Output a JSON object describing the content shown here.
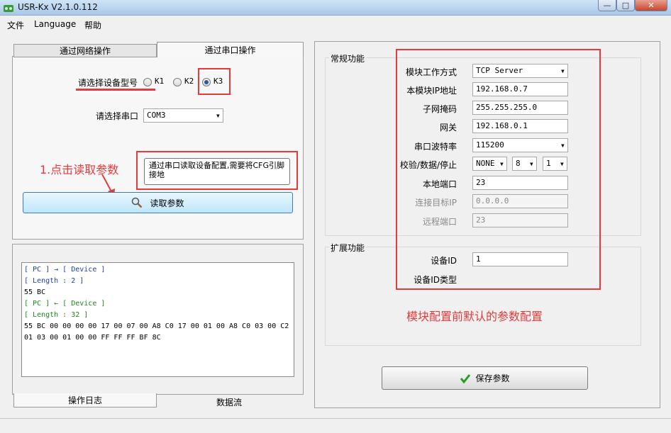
{
  "window": {
    "title": "USR-Kx V2.1.0.112"
  },
  "menu": {
    "file": "文件",
    "language": "Language",
    "help": "帮助"
  },
  "left": {
    "tabs": {
      "network": "通过网络操作",
      "serial": "通过串口操作"
    },
    "device_label": "请选择设备型号",
    "radios": {
      "k1": "K1",
      "k2": "K2",
      "k3": "K3"
    },
    "port_label": "请选择串口",
    "port_value": "COM3",
    "annotation": "1.点击读取参数",
    "tooltip": "通过串口读取设备配置,需要将CFG引脚接地",
    "read_button": "读取参数"
  },
  "log": {
    "lines": {
      "l1": "[ PC ] → [ Device ]",
      "l2": "[ Length : 2 ]",
      "l3": "55 BC",
      "l4": "[ PC ] ← [ Device ]",
      "l5": "[ Length : 32 ]",
      "l6": "55 BC 00 00 00 00 17 00 07 00 A8 C0 17 00 01 00 A8 C0 03 00 C2",
      "l7": "01 03 00 01 00 00 FF FF FF BF 8C"
    },
    "tabs": {
      "log": "操作日志",
      "stream": "数据流"
    }
  },
  "general": {
    "title": "常规功能",
    "mode_label": "模块工作方式",
    "mode_value": "TCP Server",
    "ip_label": "本模块IP地址",
    "ip_value": "192.168.0.7",
    "mask_label": "子网掩码",
    "mask_value": "255.255.255.0",
    "gateway_label": "网关",
    "gateway_value": "192.168.0.1",
    "baud_label": "串口波特率",
    "baud_value": "115200",
    "parity_label": "校验/数据/停止",
    "parity_value": "NONE",
    "data_value": "8",
    "stop_value": "1",
    "local_port_label": "本地端口",
    "local_port_value": "23",
    "target_ip_label": "连接目标IP",
    "target_ip_value": "0.0.0.0",
    "remote_port_label": "远程端口",
    "remote_port_value": "23"
  },
  "extended": {
    "title": "扩展功能",
    "device_id_label": "设备ID",
    "device_id_value": "1",
    "device_id_type_label": "设备ID类型"
  },
  "annotation_right": "模块配置前默认的参数配置",
  "save_button": "保存参数",
  "colors": {
    "annotation_red": "#e53b3b",
    "log_blue": "#1a3fc0",
    "log_green": "#1a8a1a"
  }
}
